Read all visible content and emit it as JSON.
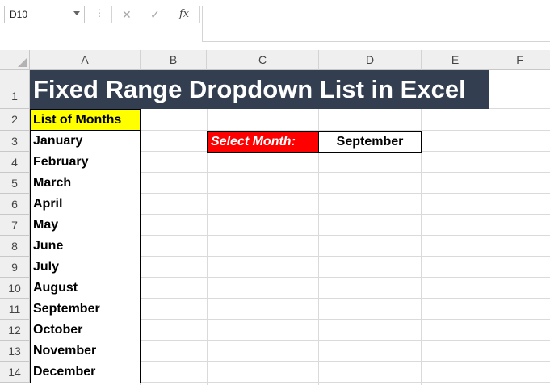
{
  "formula_bar": {
    "name_box": "D10",
    "dots": "⋮",
    "cancel_glyph": "✕",
    "enter_glyph": "✓",
    "function_glyph": "fx",
    "formula": ""
  },
  "columns": [
    "A",
    "B",
    "C",
    "D",
    "E",
    "F"
  ],
  "rows": [
    "1",
    "2",
    "3",
    "4",
    "5",
    "6",
    "7",
    "8",
    "9",
    "10",
    "11",
    "12",
    "13",
    "14"
  ],
  "sheet": {
    "title": "Fixed Range Dropdown List in Excel",
    "list_header": "List of Months",
    "months": [
      "January",
      "February",
      "March",
      "April",
      "May",
      "June",
      "July",
      "August",
      "September",
      "October",
      "November",
      "December"
    ],
    "select_label": "Select Month:",
    "select_value": "September"
  },
  "colors": {
    "title_bg": "#333f50",
    "list_header_bg": "#ffff00",
    "select_label_bg": "#ff0000",
    "header_bg": "#efefef"
  }
}
